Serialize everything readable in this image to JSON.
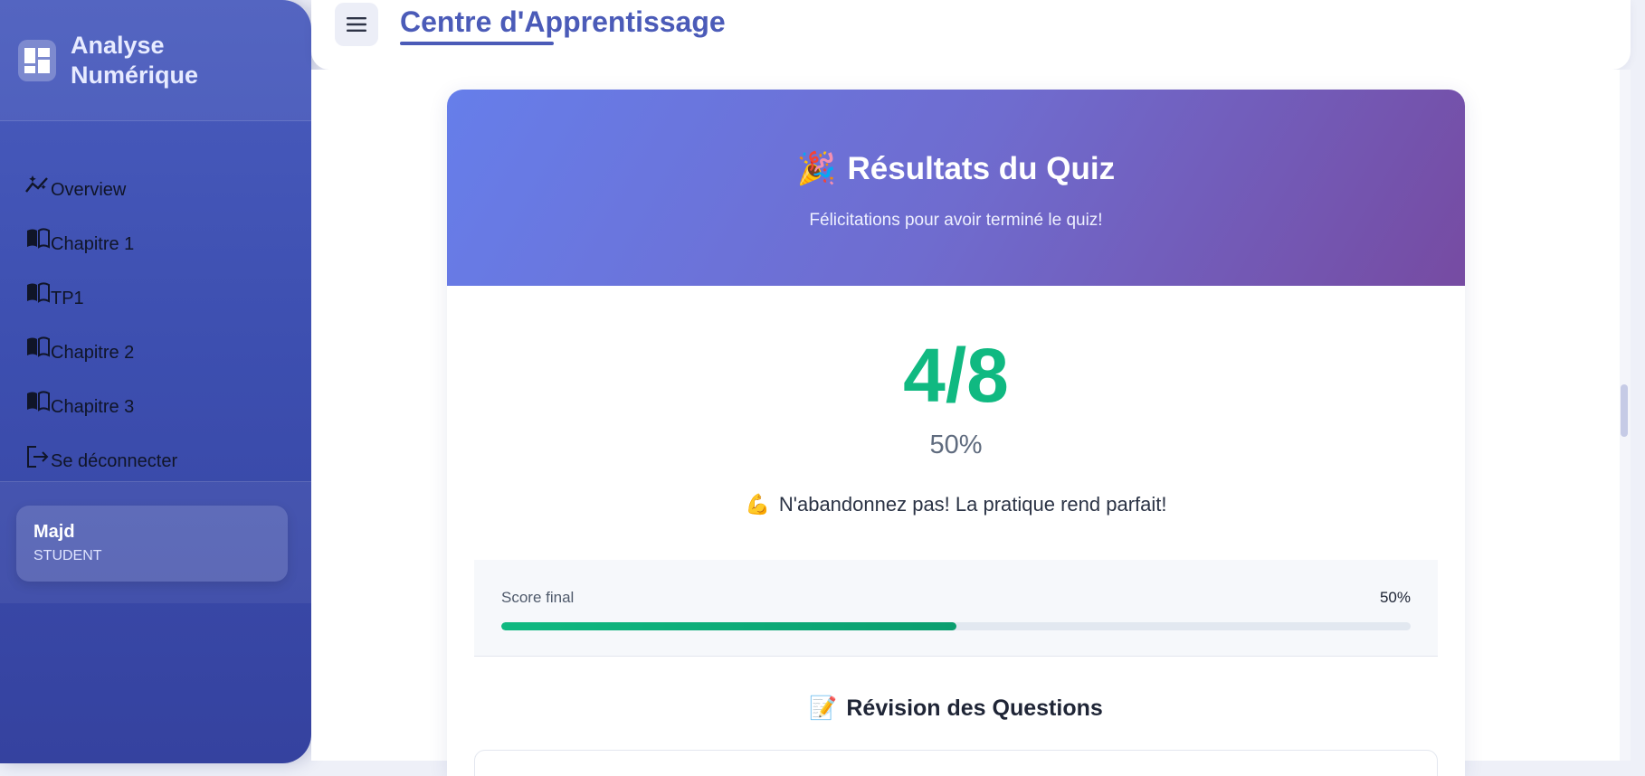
{
  "app": {
    "brand": "Analyse Numérique",
    "page_title": "Centre d'Apprentissage"
  },
  "sidebar": {
    "items": [
      {
        "label": "Overview",
        "icon": "chart-line-icon"
      },
      {
        "label": "Chapitre 1",
        "icon": "book-icon"
      },
      {
        "label": "TP1",
        "icon": "book-icon"
      },
      {
        "label": "Chapitre 2",
        "icon": "book-icon"
      },
      {
        "label": "Chapitre 3",
        "icon": "book-icon"
      },
      {
        "label": "Se déconnecter",
        "icon": "logout-icon"
      }
    ],
    "user": {
      "name": "Majd",
      "role": "STUDENT"
    }
  },
  "quiz": {
    "title": "Résultats du Quiz",
    "title_icon": "🎉",
    "subtitle": "Félicitations pour avoir terminé le quiz!",
    "score": "4/8",
    "percent": "50%",
    "motivation_icon": "💪",
    "motivation": "N'abandonnez pas! La pratique rend parfait!",
    "final_score_label": "Score final",
    "final_score_value": "50%",
    "progress_fraction": 0.5,
    "review_icon": "📝",
    "review_title": "Révision des Questions"
  },
  "colors": {
    "accent": "#4b5bb8",
    "success": "#10b981",
    "header_gradient_start": "#667eea",
    "header_gradient_end": "#764ba2"
  }
}
